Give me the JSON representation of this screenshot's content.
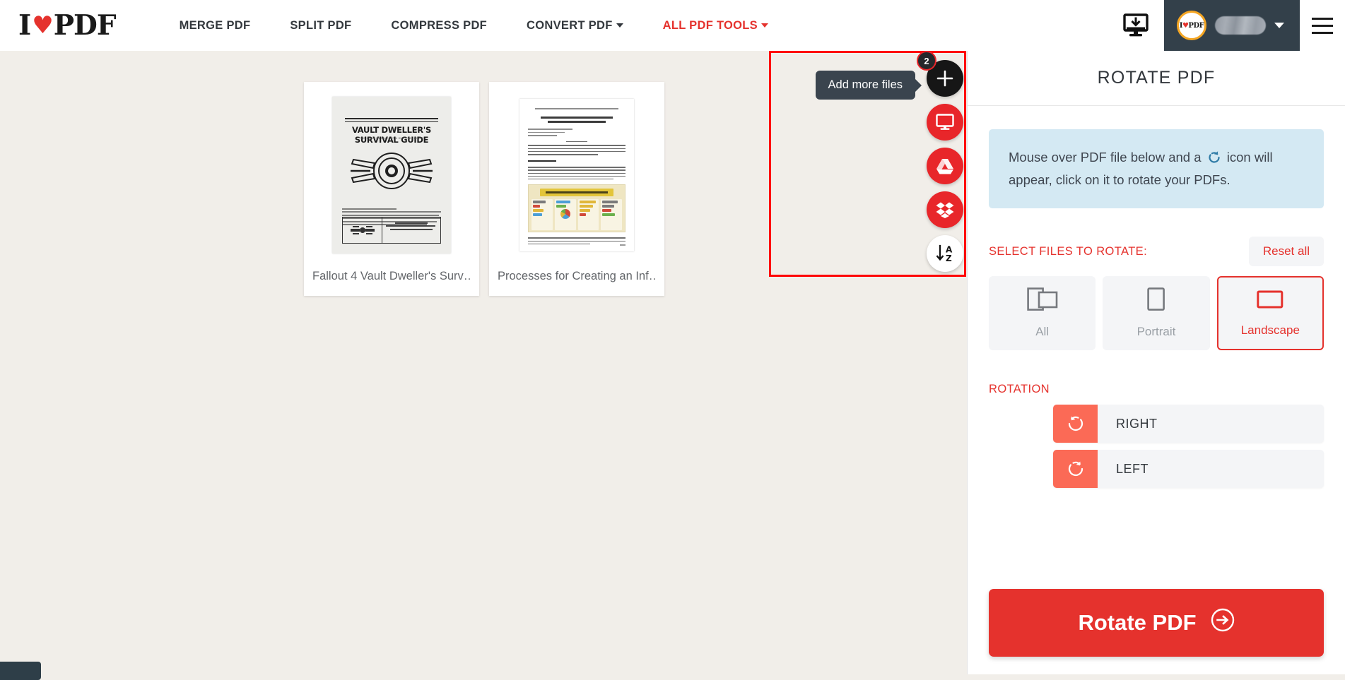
{
  "header": {
    "logo": {
      "pre": "I",
      "heart": "♥",
      "post": "PDF",
      "icon": "ilovepdf-logo"
    },
    "nav": [
      {
        "label": "MERGE PDF",
        "accent": false,
        "caret": false
      },
      {
        "label": "SPLIT PDF",
        "accent": false,
        "caret": false
      },
      {
        "label": "COMPRESS PDF",
        "accent": false,
        "caret": false
      },
      {
        "label": "CONVERT PDF",
        "accent": false,
        "caret": true
      },
      {
        "label": "ALL PDF TOOLS",
        "accent": true,
        "caret": true
      }
    ],
    "desktop_icon": "desktop-download-icon",
    "account": {
      "avatar_text_pre": "I",
      "avatar_heart": "♥",
      "avatar_text_post": "PDF",
      "username": "",
      "caret_icon": "chevron-down-icon"
    },
    "menu_icon": "hamburger-menu-icon"
  },
  "canvas": {
    "files": [
      {
        "name": "Fallout 4 Vault Dweller's Surv…",
        "thumb_title": "VAULT DWELLER'S SURVIVAL GUIDE",
        "thumb_sub": "THE OFFICIAL FALLOUT 4 SURVIVAL GUIDE"
      },
      {
        "name": "Processes for Creating an Inf…",
        "thumb_title": "Processes of Creating Infographics for Data Visualization"
      }
    ],
    "add_panel": {
      "tooltip": "Add more files",
      "badge_count": "2",
      "actions": [
        {
          "name": "add-more-files-button",
          "icon": "plus-icon"
        },
        {
          "name": "upload-from-computer-button",
          "icon": "monitor-icon"
        },
        {
          "name": "upload-from-google-drive-button",
          "icon": "google-drive-icon"
        },
        {
          "name": "upload-from-dropbox-button",
          "icon": "dropbox-icon"
        },
        {
          "name": "sort-files-az-button",
          "icon": "sort-az-icon"
        }
      ]
    }
  },
  "sidebar": {
    "title": "ROTATE PDF",
    "info": {
      "part1": "Mouse over PDF file below and a",
      "icon": "rotate-left-icon",
      "part2": "icon will appear, click on it to rotate your PDFs."
    },
    "select_files_label": "SELECT FILES TO ROTATE:",
    "reset_label": "Reset all",
    "file_types": [
      {
        "label": "All",
        "icon": "all-pages-icon",
        "selected": false
      },
      {
        "label": "Portrait",
        "icon": "portrait-page-icon",
        "selected": false
      },
      {
        "label": "Landscape",
        "icon": "landscape-page-icon",
        "selected": true
      }
    ],
    "rotation_label": "ROTATION",
    "rotation_options": [
      {
        "label": "RIGHT",
        "icon": "rotate-right-icon"
      },
      {
        "label": "LEFT",
        "icon": "rotate-left-icon"
      }
    ],
    "cta_label": "Rotate PDF",
    "cta_icon": "arrow-right-circle-icon"
  },
  "colors": {
    "brand_red": "#E5322D",
    "accent_coral": "#FB6A56",
    "dark": "#33383D",
    "info_blue": "#D4E9F3",
    "canvas_bg": "#F1EEE9",
    "highlight": "#FF0000"
  }
}
